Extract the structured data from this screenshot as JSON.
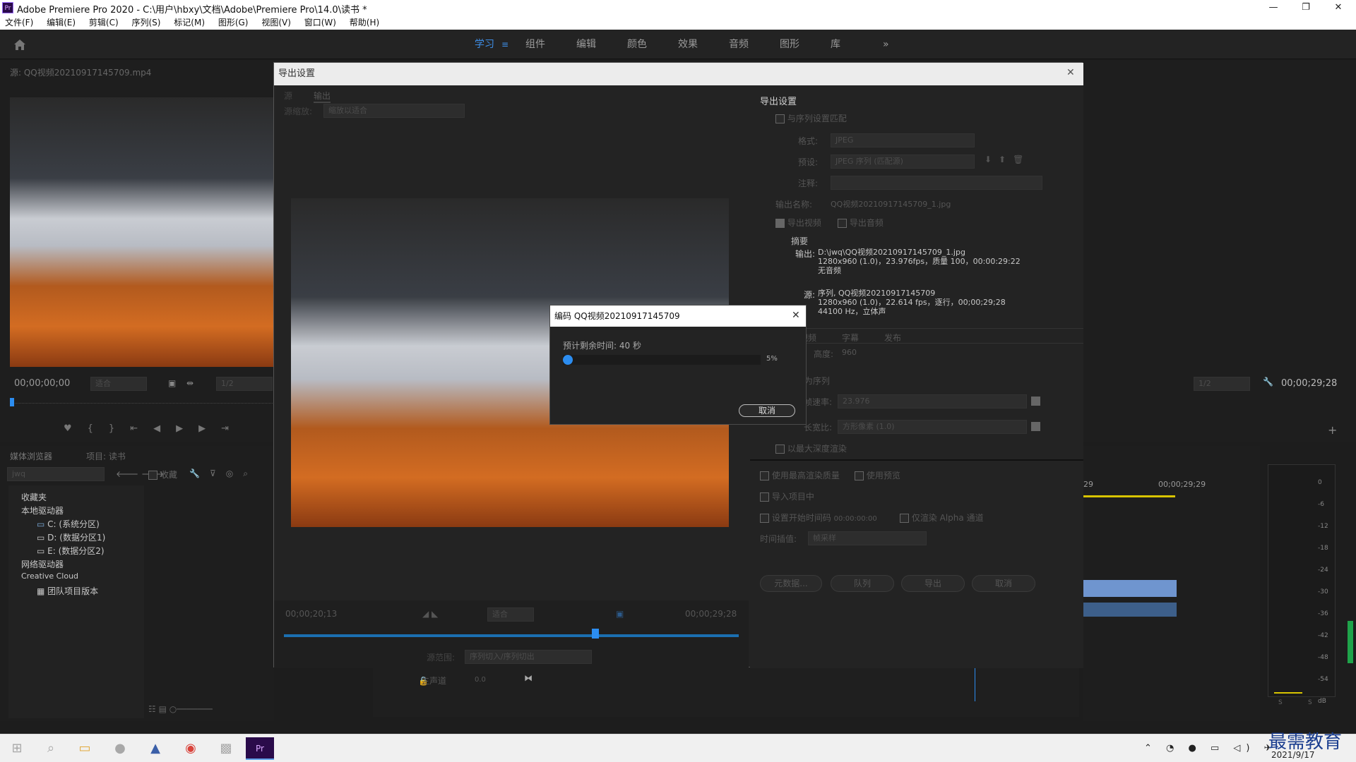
{
  "window": {
    "title": "Adobe Premiere Pro 2020 - C:\\用户\\hbxy\\文档\\Adobe\\Premiere Pro\\14.0\\读书 *",
    "min": "—",
    "max": "❐",
    "close": "✕"
  },
  "menu": [
    "文件(F)",
    "编辑(E)",
    "剪辑(C)",
    "序列(S)",
    "标记(M)",
    "图形(G)",
    "视图(V)",
    "窗口(W)",
    "帮助(H)"
  ],
  "workspaces": {
    "items": [
      "学习",
      "组件",
      "编辑",
      "颜色",
      "效果",
      "音频",
      "图形",
      "库"
    ],
    "active": "学习",
    "more": "»"
  },
  "source": {
    "tab": "源: QQ视频20210917145709.mp4",
    "timecode": "00;00;00;00",
    "fit": "适合",
    "ratio": "1/2"
  },
  "browser": {
    "tabs": [
      "媒体浏览器",
      "项目: 读书"
    ],
    "search": "jwq",
    "favorites_label": "收藏",
    "tree": [
      "收藏夹",
      "本地驱动器",
      "C: (系统分区)",
      "D: (数据分区1)",
      "E: (数据分区2)",
      "网络驱动器",
      "Creative Cloud",
      "团队项目版本"
    ]
  },
  "program": {
    "ratio": "1/2",
    "timecode": "00;00;29;28",
    "ruler": [
      "29",
      "00;00;29;29"
    ]
  },
  "meter_ticks": [
    "0",
    "-6",
    "-12",
    "-18",
    "-24",
    "-30",
    "-36",
    "-42",
    "-48",
    "-54",
    "dB"
  ],
  "meter_solo": [
    "S",
    "S"
  ],
  "timeline": {
    "master": "主声道",
    "level": "0.0"
  },
  "dialog": {
    "title": "导出设置",
    "left_tabs": [
      "源",
      "输出"
    ],
    "source_scale_label": "源缩放:",
    "source_scale_value": "缩放以适合",
    "tc_in": "00;00;20;13",
    "tc_out": "00;00;29;28",
    "fit": "适合",
    "range_label": "源范围:",
    "range_value": "序列切入/序列切出",
    "export_settings": {
      "header": "导出设置",
      "match_seq": "与序列设置匹配",
      "format_label": "格式:",
      "format_value": "JPEG",
      "preset_label": "预设:",
      "preset_value": "JPEG 序列 (匹配源)",
      "comment_label": "注释:",
      "output_name_label": "输出名称:",
      "output_name_value": "QQ视频20210917145709_1.jpg",
      "export_video": "导出视频",
      "export_audio": "导出音频",
      "summary_header": "摘要",
      "output_label": "输出:",
      "output_lines": [
        "D:\\jwq\\QQ视频20210917145709_1.jpg",
        "1280x960 (1.0)，23.976fps，质量 100，00:00:29:22",
        "无音频"
      ],
      "source_label": "源:",
      "source_lines": [
        "序列, QQ视频20210917145709",
        "1280x960 (1.0)，22.614 fps，逐行，00;00;29;28",
        "44100 Hz，立体声"
      ]
    },
    "right_tabs": [
      "视频",
      "字幕",
      "发布"
    ],
    "height_label": "高度:",
    "height_value": "960",
    "export_as_seq": "导出为序列",
    "framerate_label": "帧速率:",
    "framerate_value": "23.976",
    "aspect_label": "长宽比:",
    "aspect_value": "方形像素 (1.0)",
    "max_depth": "以最大深度渲染",
    "max_quality": "使用最高渲染质量",
    "use_preview": "使用预览",
    "import_project": "导入项目中",
    "set_start_tc": "设置开始时间码",
    "start_tc": "00:00:00:00",
    "alpha_only": "仅渲染 Alpha 通道",
    "interp_label": "时间插值:",
    "interp_value": "帧采样",
    "buttons": [
      "元数据...",
      "队列",
      "导出",
      "取消"
    ]
  },
  "encoding": {
    "title": "编码 QQ视频20210917145709",
    "remaining": "预计剩余时间: 40 秒",
    "progress_percent": 5,
    "percent_label": "5%",
    "cancel": "取消"
  },
  "taskbar": {
    "time": "2021/9/17",
    "watermark": "最需教育"
  },
  "colors": {
    "accent": "#2c8df0",
    "workspace_active": "#3e8ee6"
  }
}
